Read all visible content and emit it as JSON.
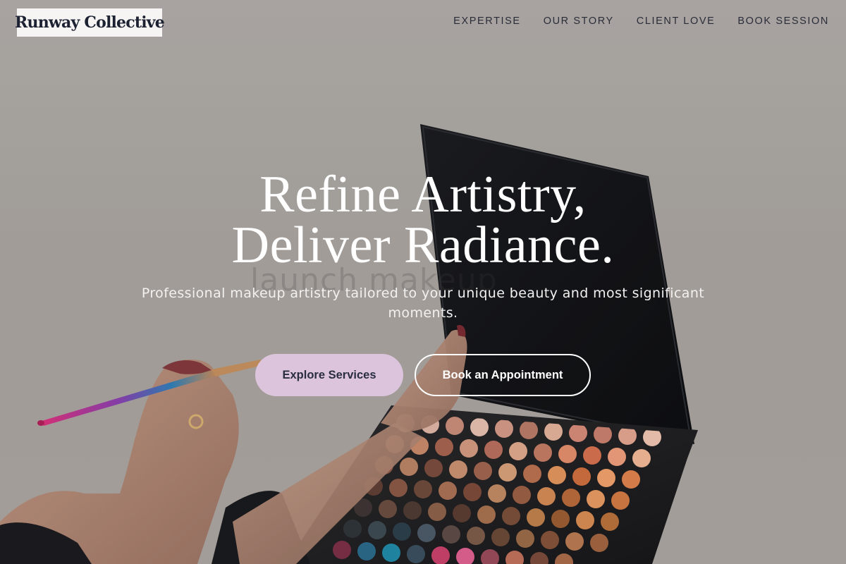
{
  "brand": {
    "name": "Runway Collective"
  },
  "nav": {
    "items": [
      {
        "label": "EXPERTISE"
      },
      {
        "label": "OUR STORY"
      },
      {
        "label": "CLIENT LOVE"
      },
      {
        "label": "BOOK SESSION"
      }
    ]
  },
  "hero": {
    "headline_line1": "Refine Artistry,",
    "headline_line2": "Deliver Radiance.",
    "subtitle": "Professional makeup artistry tailored to your unique beauty and most significant moments.",
    "background_text": "launch makeup",
    "primary_cta": "Explore Services",
    "secondary_cta": "Book an Appointment"
  },
  "colors": {
    "primary_button": "#dcc4dc",
    "text_dark": "#2a2d40",
    "logo_bg": "#f7f5f3",
    "headline": "#ffffff"
  },
  "icons": {
    "background_image": "makeup-palette-photo"
  }
}
